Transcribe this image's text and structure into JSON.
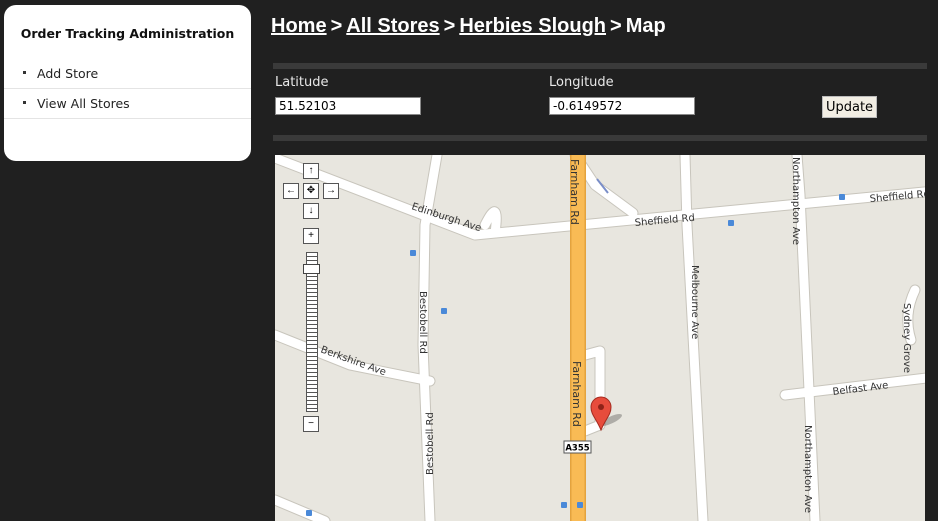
{
  "sidebar": {
    "title": "Order Tracking Administration",
    "items": [
      {
        "label": "Add Store"
      },
      {
        "label": "View All Stores"
      }
    ]
  },
  "breadcrumb": {
    "crumbs": [
      {
        "label": "Home"
      },
      {
        "label": "All Stores"
      },
      {
        "label": "Herbies Slough"
      }
    ],
    "separator": ">",
    "current": "Map"
  },
  "form": {
    "latitude_label": "Latitude",
    "latitude_value": "51.52103",
    "longitude_label": "Longitude",
    "longitude_value": "-0.6149572",
    "update_label": "Update"
  },
  "map": {
    "controls": {
      "up": "↑",
      "left": "←",
      "center": "✥",
      "right": "→",
      "down": "↓",
      "zoom_in": "+",
      "zoom_out": "−"
    },
    "streets": {
      "edinburgh": "Edinburgh Ave",
      "sheffield": "Sheffield Rd",
      "sheffield_right": "Sheffield Rd",
      "farnham_top": "Farnham Rd",
      "farnham_mid": "Farnham Rd",
      "bestobell_top": "Bestobell Rd",
      "bestobell_bottom": "Bestobell Rd",
      "melbourne": "Melbourne Ave",
      "northampton_top": "Northampton Ave",
      "northampton_bottom": "Northampton Ave",
      "berkshire": "Berkshire Ave",
      "sydney": "Sydney Grove",
      "belfast": "Belfast Ave"
    },
    "road_shield": "A355",
    "colors": {
      "land": "#e8e6df",
      "road": "#ffffff",
      "major_road": "#f9bb55",
      "marker": "#e74c3c"
    },
    "marker_icon": "map-pin-icon",
    "bus_stop_icon": "bus-stop-icon"
  }
}
